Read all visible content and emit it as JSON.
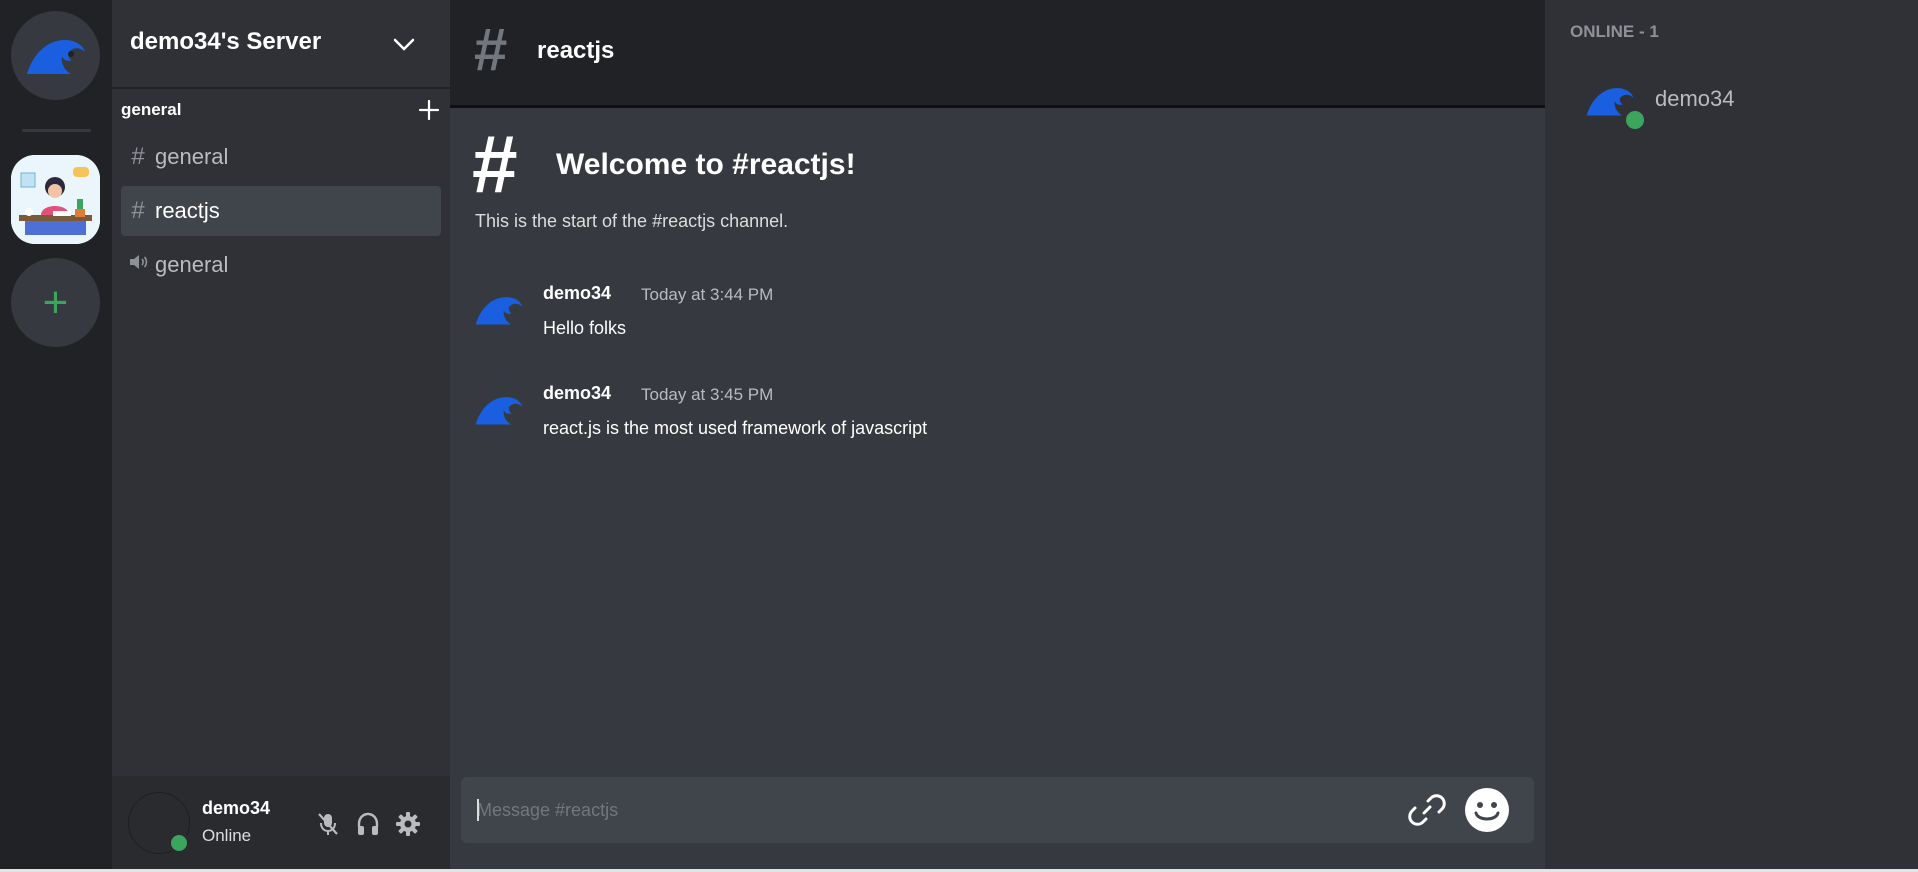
{
  "server": {
    "name": "demo34's Server"
  },
  "category": {
    "label": "general"
  },
  "channels": [
    {
      "name": "general",
      "type": "text",
      "icon": "#"
    },
    {
      "name": "reactjs",
      "type": "text",
      "icon": "#"
    },
    {
      "name": "general",
      "type": "voice",
      "icon": "speaker"
    }
  ],
  "user": {
    "name": "demo34",
    "status": "Online"
  },
  "header": {
    "hash": "#",
    "title": "reactjs"
  },
  "welcome": {
    "hash": "#",
    "title": "Welcome to #reactjs!",
    "subtitle": "This is the start of the #reactjs channel."
  },
  "messages": [
    {
      "author": "demo34",
      "time": "Today at 3:44 PM",
      "text": "Hello folks"
    },
    {
      "author": "demo34",
      "time": "Today at 3:45 PM",
      "text": "react.js is the most used framework of javascript"
    }
  ],
  "composer": {
    "placeholder": "Message #reactjs"
  },
  "members": {
    "title": "ONLINE - 1",
    "list": [
      {
        "name": "demo34"
      }
    ]
  },
  "colors": {
    "accent_blue": "#1a5fe0",
    "online_green": "#3ba55d",
    "background": "#36393f"
  }
}
